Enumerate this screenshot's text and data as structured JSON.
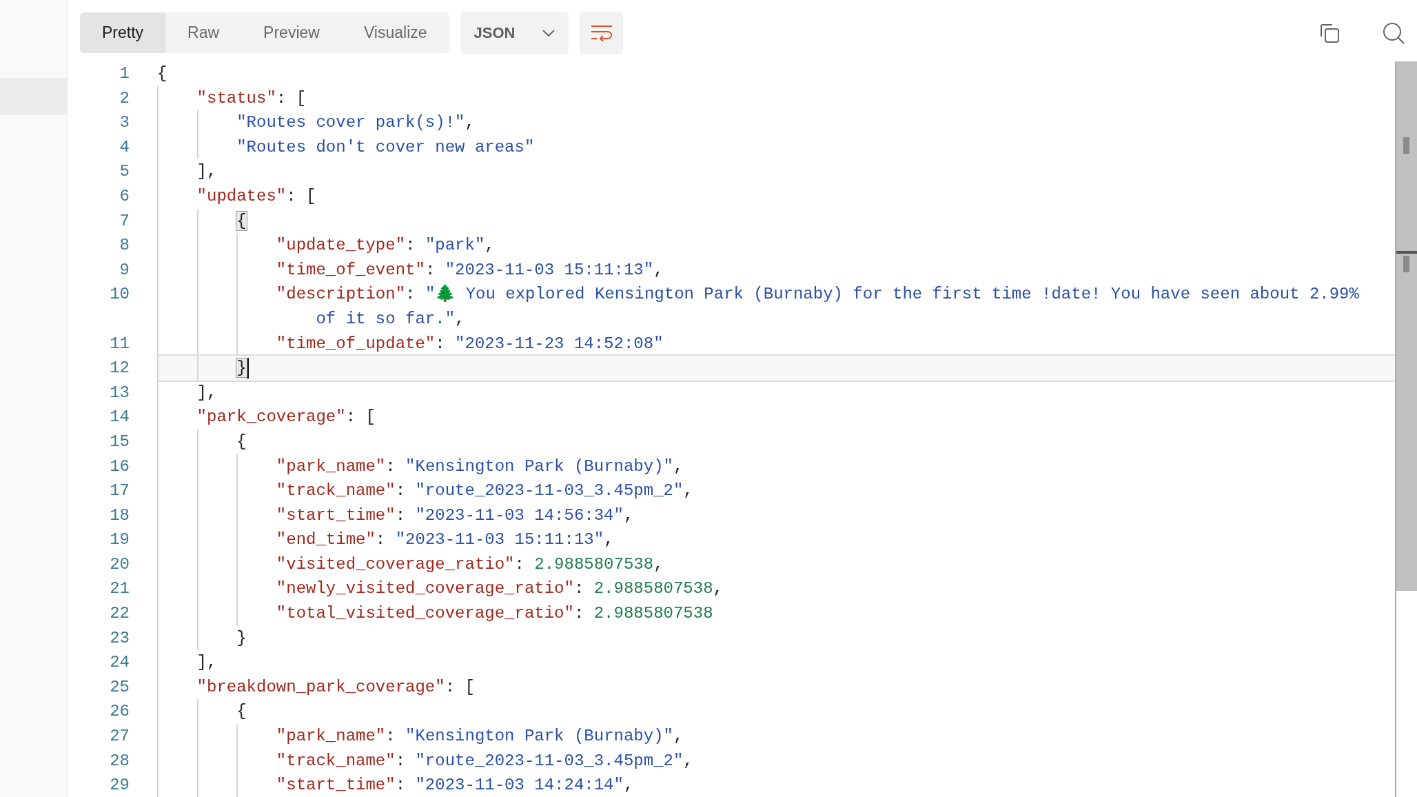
{
  "tabs": [
    {
      "label": "Pretty",
      "selected": true
    },
    {
      "label": "Raw",
      "selected": false
    },
    {
      "label": "Preview",
      "selected": false
    },
    {
      "label": "Visualize",
      "selected": false
    }
  ],
  "format_select": {
    "value": "JSON"
  },
  "lines": [
    {
      "number": "1",
      "current": false,
      "tokens": [
        {
          "kind": "punct",
          "text": "{"
        }
      ],
      "children": [
        {
          "number": "2",
          "current": false,
          "tokens": [
            {
              "kind": "key",
              "text": "\"status\""
            },
            {
              "kind": "punct",
              "text": ": ["
            }
          ],
          "children": [
            {
              "number": "3",
              "current": false,
              "tokens": [
                {
                  "kind": "string",
                  "text": "\"Routes cover park(s)!\""
                },
                {
                  "kind": "punct",
                  "text": ","
                }
              ]
            },
            {
              "number": "4",
              "current": false,
              "tokens": [
                {
                  "kind": "string",
                  "text": "\"Routes don't cover new areas\""
                }
              ]
            }
          ]
        },
        {
          "number": "5",
          "current": false,
          "tokens": [
            {
              "kind": "punct",
              "text": "],"
            }
          ]
        },
        {
          "number": "6",
          "current": false,
          "tokens": [
            {
              "kind": "key",
              "text": "\"updates\""
            },
            {
              "kind": "punct",
              "text": ": ["
            }
          ],
          "children": [
            {
              "number": "7",
              "current": false,
              "tokens": [
                {
                  "kind": "match",
                  "text": "{"
                }
              ],
              "children": [
                {
                  "number": "8",
                  "current": false,
                  "tokens": [
                    {
                      "kind": "key",
                      "text": "\"update_type\""
                    },
                    {
                      "kind": "punct",
                      "text": ": "
                    },
                    {
                      "kind": "string",
                      "text": "\"park\""
                    },
                    {
                      "kind": "punct",
                      "text": ","
                    }
                  ]
                },
                {
                  "number": "9",
                  "current": false,
                  "tokens": [
                    {
                      "kind": "key",
                      "text": "\"time_of_event\""
                    },
                    {
                      "kind": "punct",
                      "text": ": "
                    },
                    {
                      "kind": "string",
                      "text": "\"2023-11-03 15:11:13\""
                    },
                    {
                      "kind": "punct",
                      "text": ","
                    }
                  ]
                },
                {
                  "number": "10",
                  "current": false,
                  "tokens": [
                    {
                      "kind": "key",
                      "text": "\"description\""
                    },
                    {
                      "kind": "punct",
                      "text": ": "
                    },
                    {
                      "kind": "string",
                      "text": "\"🌲 You explored Kensington Park (Burnaby) for the first time !date! You have seen about 2.99% of it so far.\""
                    },
                    {
                      "kind": "punct",
                      "text": ","
                    }
                  ]
                },
                {
                  "number": "11",
                  "current": false,
                  "tokens": [
                    {
                      "kind": "key",
                      "text": "\"time_of_update\""
                    },
                    {
                      "kind": "punct",
                      "text": ": "
                    },
                    {
                      "kind": "string",
                      "text": "\"2023-11-23 14:52:08\""
                    }
                  ]
                }
              ]
            },
            {
              "number": "12",
              "current": true,
              "tokens": [
                {
                  "kind": "match",
                  "text": "}"
                }
              ]
            }
          ]
        },
        {
          "number": "13",
          "current": false,
          "tokens": [
            {
              "kind": "punct",
              "text": "],"
            }
          ]
        },
        {
          "number": "14",
          "current": false,
          "tokens": [
            {
              "kind": "key",
              "text": "\"park_coverage\""
            },
            {
              "kind": "punct",
              "text": ": ["
            }
          ],
          "children": [
            {
              "number": "15",
              "current": false,
              "tokens": [
                {
                  "kind": "punct",
                  "text": "{"
                }
              ],
              "children": [
                {
                  "number": "16",
                  "current": false,
                  "tokens": [
                    {
                      "kind": "key",
                      "text": "\"park_name\""
                    },
                    {
                      "kind": "punct",
                      "text": ": "
                    },
                    {
                      "kind": "string",
                      "text": "\"Kensington Park (Burnaby)\""
                    },
                    {
                      "kind": "punct",
                      "text": ","
                    }
                  ]
                },
                {
                  "number": "17",
                  "current": false,
                  "tokens": [
                    {
                      "kind": "key",
                      "text": "\"track_name\""
                    },
                    {
                      "kind": "punct",
                      "text": ": "
                    },
                    {
                      "kind": "string",
                      "text": "\"route_2023-11-03_3.45pm_2\""
                    },
                    {
                      "kind": "punct",
                      "text": ","
                    }
                  ]
                },
                {
                  "number": "18",
                  "current": false,
                  "tokens": [
                    {
                      "kind": "key",
                      "text": "\"start_time\""
                    },
                    {
                      "kind": "punct",
                      "text": ": "
                    },
                    {
                      "kind": "string",
                      "text": "\"2023-11-03 14:56:34\""
                    },
                    {
                      "kind": "punct",
                      "text": ","
                    }
                  ]
                },
                {
                  "number": "19",
                  "current": false,
                  "tokens": [
                    {
                      "kind": "key",
                      "text": "\"end_time\""
                    },
                    {
                      "kind": "punct",
                      "text": ": "
                    },
                    {
                      "kind": "string",
                      "text": "\"2023-11-03 15:11:13\""
                    },
                    {
                      "kind": "punct",
                      "text": ","
                    }
                  ]
                },
                {
                  "number": "20",
                  "current": false,
                  "tokens": [
                    {
                      "kind": "key",
                      "text": "\"visited_coverage_ratio\""
                    },
                    {
                      "kind": "punct",
                      "text": ": "
                    },
                    {
                      "kind": "number",
                      "text": "2.9885807538"
                    },
                    {
                      "kind": "punct",
                      "text": ","
                    }
                  ]
                },
                {
                  "number": "21",
                  "current": false,
                  "tokens": [
                    {
                      "kind": "key",
                      "text": "\"newly_visited_coverage_ratio\""
                    },
                    {
                      "kind": "punct",
                      "text": ": "
                    },
                    {
                      "kind": "number",
                      "text": "2.9885807538"
                    },
                    {
                      "kind": "punct",
                      "text": ","
                    }
                  ]
                },
                {
                  "number": "22",
                  "current": false,
                  "tokens": [
                    {
                      "kind": "key",
                      "text": "\"total_visited_coverage_ratio\""
                    },
                    {
                      "kind": "punct",
                      "text": ": "
                    },
                    {
                      "kind": "number",
                      "text": "2.9885807538"
                    }
                  ]
                }
              ]
            },
            {
              "number": "23",
              "current": false,
              "tokens": [
                {
                  "kind": "punct",
                  "text": "}"
                }
              ]
            }
          ]
        },
        {
          "number": "24",
          "current": false,
          "tokens": [
            {
              "kind": "punct",
              "text": "],"
            }
          ]
        },
        {
          "number": "25",
          "current": false,
          "tokens": [
            {
              "kind": "key",
              "text": "\"breakdown_park_coverage\""
            },
            {
              "kind": "punct",
              "text": ": ["
            }
          ],
          "children": [
            {
              "number": "26",
              "current": false,
              "tokens": [
                {
                  "kind": "punct",
                  "text": "{"
                }
              ],
              "children": [
                {
                  "number": "27",
                  "current": false,
                  "tokens": [
                    {
                      "kind": "key",
                      "text": "\"park_name\""
                    },
                    {
                      "kind": "punct",
                      "text": ": "
                    },
                    {
                      "kind": "string",
                      "text": "\"Kensington Park (Burnaby)\""
                    },
                    {
                      "kind": "punct",
                      "text": ","
                    }
                  ]
                },
                {
                  "number": "28",
                  "current": false,
                  "tokens": [
                    {
                      "kind": "key",
                      "text": "\"track_name\""
                    },
                    {
                      "kind": "punct",
                      "text": ": "
                    },
                    {
                      "kind": "string",
                      "text": "\"route_2023-11-03_3.45pm_2\""
                    },
                    {
                      "kind": "punct",
                      "text": ","
                    }
                  ]
                },
                {
                  "number": "29",
                  "current": false,
                  "tokens": [
                    {
                      "kind": "key",
                      "text": "\"start_time\""
                    },
                    {
                      "kind": "punct",
                      "text": ": "
                    },
                    {
                      "kind": "string",
                      "text": "\"2023-11-03 14:24:14\""
                    },
                    {
                      "kind": "punct",
                      "text": ","
                    }
                  ]
                }
              ]
            }
          ]
        }
      ]
    }
  ]
}
